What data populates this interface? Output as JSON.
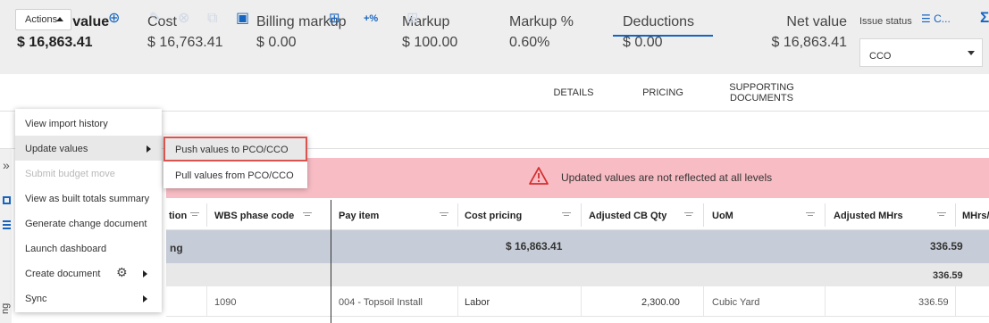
{
  "summary": {
    "current_value": {
      "label": "Current value",
      "value": "$ 16,863.41"
    },
    "cost": {
      "label": "Cost",
      "value": "$ 16,763.41"
    },
    "billing_markup": {
      "label": "Billing markup",
      "value": "$ 0.00"
    },
    "markup": {
      "label": "Markup",
      "value": "$ 100.00"
    },
    "markup_pct": {
      "label": "Markup %",
      "value": "0.60%"
    },
    "deductions": {
      "label": "Deductions",
      "value": "$ 0.00"
    },
    "net_value": {
      "label": "Net value",
      "value": "$ 16,863.41"
    },
    "issue_status": {
      "label": "Issue status",
      "value": "CCO"
    }
  },
  "toolbar": {
    "actions_label": "Actions",
    "pct_label": "+%",
    "tabs": [
      {
        "label": "DETAILS",
        "active": false
      },
      {
        "label": "PRICING",
        "active": true
      },
      {
        "label": "SUPPORTING DOCUMENTS",
        "active": false
      }
    ],
    "filter_label": "C...",
    "sigma": "Σ",
    "accent_color": "#1565c0"
  },
  "menu": {
    "items": [
      {
        "label": "View import history",
        "disabled": false,
        "submenu": false
      },
      {
        "label": "Update values",
        "disabled": false,
        "submenu": true,
        "highlighted": true
      },
      {
        "label": "Submit budget move",
        "disabled": true,
        "submenu": false
      },
      {
        "label": "View as built totals summary",
        "disabled": false,
        "submenu": false
      },
      {
        "label": "Generate change document",
        "disabled": false,
        "submenu": false
      },
      {
        "label": "Launch dashboard",
        "disabled": false,
        "submenu": false
      },
      {
        "label": "Create document",
        "disabled": false,
        "submenu": true,
        "icon": "gear-icon"
      },
      {
        "label": "Sync",
        "disabled": false,
        "submenu": true
      }
    ],
    "submenu_items": [
      {
        "label": "Push values to PCO/CCO",
        "highlighted": true
      },
      {
        "label": "Pull values from PCO/CCO",
        "highlighted": false
      }
    ]
  },
  "warning": {
    "text": "Updated values are not reflected at all levels",
    "color": "#f8bcc4"
  },
  "grid": {
    "headers": [
      "tion",
      "WBS phase code",
      "Pay item",
      "Cost pricing",
      "Adjusted CB Qty",
      "UoM",
      "Adjusted MHrs",
      "MHrs/"
    ],
    "group_row": {
      "label": "ng",
      "cost": "$ 16,863.41",
      "mhrs": "336.59"
    },
    "subgroup_row": {
      "mhrs": "336.59"
    },
    "data_row": {
      "wbs": "1090",
      "pay_item": "004 - Topsoil Install",
      "cost_pricing": "Labor",
      "qty": "2,300.00",
      "uom": "Cubic Yard",
      "mhrs": "336.59"
    },
    "side_text": "ng"
  }
}
